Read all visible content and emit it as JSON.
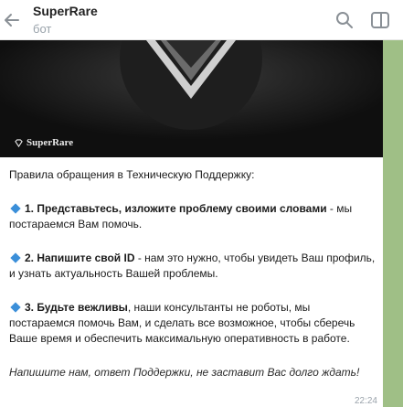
{
  "header": {
    "title": "SuperRare",
    "subtitle": "бот",
    "back_icon": "arrow-left-icon",
    "search_icon": "search-icon",
    "sidebar_icon": "sidebar-toggle-icon"
  },
  "media": {
    "brand_text": "SuperRare",
    "logo_icon": "superrare-diamond-icon"
  },
  "message": {
    "intro": "Правила обращения в Техническую Поддержку:",
    "rule1_bold": "1. Представьтесь, изложите проблему своими словами",
    "rule1_rest": " - мы постараемся Вам помочь.",
    "rule2_bold": "2. Напишите свой ID",
    "rule2_rest": " - нам это нужно, чтобы увидеть Ваш профиль, и узнать актуальность Вашей проблемы.",
    "rule3_bold": "3. Будьте вежливы",
    "rule3_rest": ", наши консультанты не роботы, мы постараемся помочь Вам, и сделать все возможное, чтобы сберечь Ваше время и обеспечить максимальную оперативность в работе.",
    "closing": "Напишите нам, ответ Поддержки, не заставит Вас долго ждать!",
    "time": "22:24"
  },
  "colors": {
    "accent": "#3b8fd9",
    "chat_background": "#9fbf86"
  }
}
